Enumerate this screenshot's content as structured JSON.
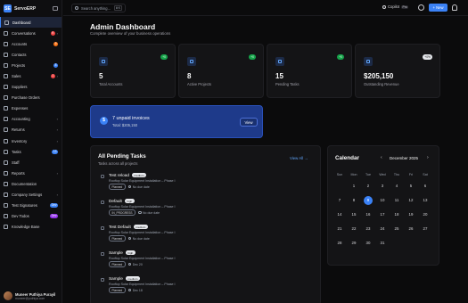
{
  "brand": {
    "name": "ServoERP",
    "logo_letter": "SE"
  },
  "sidebar": {
    "items": [
      {
        "label": "Dashboard",
        "icon": "dashboard-icon",
        "active": true
      },
      {
        "label": "Conversations",
        "icon": "chat-icon",
        "badge": "9",
        "badge_color": "red",
        "chevron": "›"
      },
      {
        "label": "Accounts",
        "icon": "building-icon",
        "badge": "9",
        "badge_color": "orange"
      },
      {
        "label": "Contacts",
        "icon": "contact-icon"
      },
      {
        "label": "Projects",
        "icon": "folder-icon",
        "badge": "8",
        "badge_color": "blue"
      },
      {
        "label": "Sales",
        "icon": "cart-icon",
        "badge": "1",
        "badge_color": "red",
        "chevron": "›"
      },
      {
        "label": "Suppliers",
        "icon": "truck-icon"
      },
      {
        "label": "Purchase Orders",
        "icon": "clipboard-icon"
      },
      {
        "label": "Expenses",
        "icon": "wallet-icon"
      },
      {
        "label": "Accounting",
        "icon": "calculator-icon",
        "chevron": "›"
      },
      {
        "label": "Returns",
        "icon": "return-icon",
        "chevron": "›"
      },
      {
        "label": "Inventory",
        "icon": "box-icon",
        "chevron": "›"
      },
      {
        "label": "Tasks",
        "icon": "checklist-icon",
        "badge": "13",
        "badge_color": "blue"
      },
      {
        "label": "Staff",
        "icon": "people-icon"
      },
      {
        "label": "Reports",
        "icon": "chart-icon",
        "chevron": "›"
      },
      {
        "label": "Documentation",
        "icon": "book-icon"
      },
      {
        "label": "Company Settings",
        "icon": "gear-icon",
        "chevron": "›"
      },
      {
        "label": "Test Signatures",
        "icon": "pen-icon",
        "badge": "Dev",
        "badge_color": "blue"
      },
      {
        "label": "Dev Todos",
        "icon": "code-icon",
        "badge": "Dev",
        "badge_color": "purple"
      },
      {
        "label": "Knowledge Base",
        "icon": "library-icon"
      }
    ]
  },
  "user": {
    "name": "Muneer Puthiya Purayil",
    "email": "muneer@puthiya.com"
  },
  "topbar": {
    "search_placeholder": "Search anything...",
    "search_shortcut": "⌘K",
    "copilot_label": "Copilot",
    "copilot_badge": "Pro",
    "new_label": "+ New"
  },
  "page": {
    "title": "Admin Dashboard",
    "subtitle": "Complete overview of your business operations"
  },
  "stats": [
    {
      "value": "5",
      "label": "Total Accounts",
      "badge": "+0",
      "badge_style": "green",
      "icon": "building-icon"
    },
    {
      "value": "8",
      "label": "Active Projects",
      "badge": "+0",
      "badge_style": "green",
      "icon": "folder-icon"
    },
    {
      "value": "15",
      "label": "Pending Tasks",
      "badge": "+0",
      "badge_style": "green",
      "icon": "checklist-icon"
    },
    {
      "value": "$205,150",
      "label": "Outstanding Revenue",
      "badge": "+0%",
      "badge_style": "grey",
      "icon": "dollar-icon"
    }
  ],
  "invoice_alert": {
    "title": "7 unpaid invoices",
    "subtitle": "Total: $205,150",
    "button": "View"
  },
  "tasks_panel": {
    "title": "All Pending Tasks",
    "subtitle": "Tasks across all projects",
    "view_all": "View All  →",
    "items": [
      {
        "name": "Test reload",
        "priority": "medium",
        "desc": "Rooftop Solar Equipment Installation – Phase I",
        "status": "Planned",
        "date": "No due date"
      },
      {
        "name": "Default",
        "priority": "high",
        "desc": "Rooftop Solar Equipment Installation – Phase I",
        "status": "IN_PROGRESS",
        "date": "No due date"
      },
      {
        "name": "Test Default",
        "priority": "medium",
        "desc": "Rooftop Solar Equipment Installation – Phase I",
        "status": "Planned",
        "date": "No due date"
      },
      {
        "name": "Sample",
        "priority": "high",
        "desc": "Rooftop Solar Equipment Installation – Phase I",
        "status": "Planned",
        "date": "Dec 20"
      },
      {
        "name": "Sample",
        "priority": "medium",
        "desc": "Rooftop Solar Equipment Installation – Phase I",
        "status": "Planned",
        "date": "Dec 18"
      }
    ]
  },
  "calendar": {
    "title": "Calendar",
    "month": "December 2025",
    "prev": "‹",
    "next": "›",
    "weekdays": [
      "Sun",
      "Mon",
      "Tue",
      "Wed",
      "Thu",
      "Fri",
      "Sat"
    ],
    "weeks": [
      [
        "",
        "1",
        "2",
        "3",
        "4",
        "5",
        "6"
      ],
      [
        "7",
        "8",
        "9",
        "10",
        "11",
        "12",
        "13"
      ],
      [
        "14",
        "15",
        "16",
        "17",
        "18",
        "19",
        "20"
      ],
      [
        "21",
        "22",
        "23",
        "24",
        "25",
        "26",
        "27"
      ],
      [
        "28",
        "29",
        "30",
        "31",
        "",
        "",
        ""
      ]
    ],
    "today": "9"
  },
  "colors": {
    "accent": "#3b82f6",
    "background": "#0b0b0c",
    "panel": "#141416",
    "invoice_banner": "#1e3a8a"
  }
}
